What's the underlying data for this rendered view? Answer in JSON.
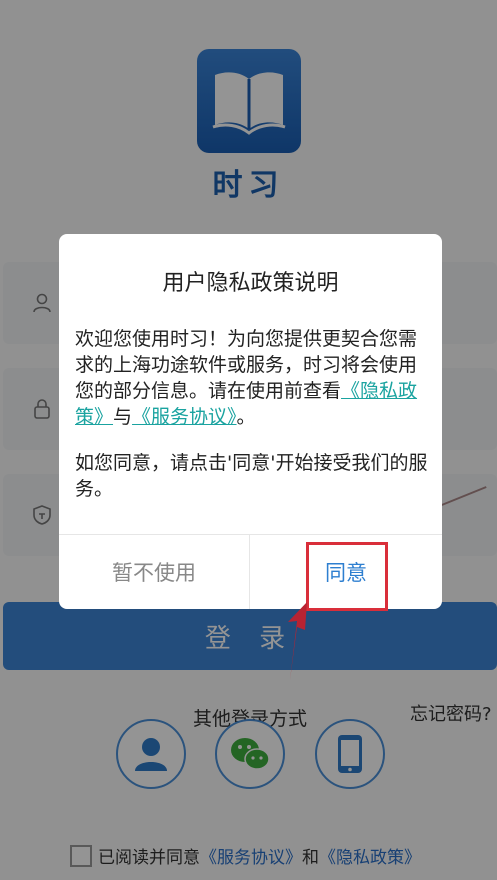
{
  "app": {
    "name": "时习"
  },
  "login": {
    "button_label": "登 录",
    "other_methods_label": "其他登录方式",
    "forgot_password": "忘记密码?"
  },
  "agreement": {
    "prefix": "已阅读并同意",
    "service": "《服务协议》",
    "and": "和",
    "privacy": "《隐私政策》"
  },
  "dialog": {
    "title": "用户隐私政策说明",
    "p1_text1": "欢迎您使用时习！为向您提供更契合您需求的上海功途软件或服务，时习将会使用您的部分信息。请在使用前查看",
    "p1_link1": "《隐私政策》",
    "p1_text2": "与",
    "p1_link2": "《服务协议》",
    "p1_text3": "。",
    "p2": "如您同意，请点击'同意'开始接受我们的服务。",
    "cancel_label": "暂不使用",
    "agree_label": "同意"
  },
  "colors": {
    "brand": "#1d5fae",
    "primary_button": "#3d86d6",
    "link_teal": "#1aa3a0",
    "annotation_red": "#d92e3a"
  },
  "icons": [
    "book-logo-icon",
    "user-icon",
    "lock-icon",
    "shield-icon",
    "person-icon",
    "wechat-icon",
    "phone-icon",
    "arrow-annotation-icon"
  ]
}
